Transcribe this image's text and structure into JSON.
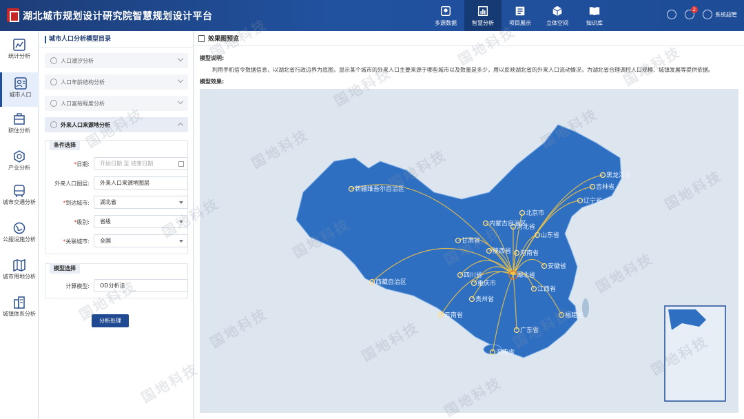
{
  "header": {
    "title": "湖北城市规划设计研究院智慧规划设计平台",
    "nav": [
      {
        "label": "多源数据",
        "icon": "map-pin-icon"
      },
      {
        "label": "智慧分析",
        "icon": "chart-icon",
        "active": true
      },
      {
        "label": "项目展示",
        "icon": "list-icon"
      },
      {
        "label": "立体空间",
        "icon": "cube-icon"
      },
      {
        "label": "知识库",
        "icon": "book-icon"
      }
    ],
    "notification_count": "2",
    "user_name": "系统超管"
  },
  "rail": [
    {
      "label": "统计分析",
      "icon": "chart-icon"
    },
    {
      "label": "城市人口",
      "icon": "person-card-icon",
      "active": true
    },
    {
      "label": "职住分析",
      "icon": "building-icon"
    },
    {
      "label": "产业分析",
      "icon": "hexagon-icon"
    },
    {
      "label": "城市交通分析",
      "icon": "bus-icon"
    },
    {
      "label": "公服设施分析",
      "icon": "globe-icon"
    },
    {
      "label": "城市用地分析",
      "icon": "map-icon"
    },
    {
      "label": "城镇体系分析",
      "icon": "city-icon"
    }
  ],
  "panel": {
    "title": "城市人口分析模型目录",
    "accordion": [
      "人口潮汐分析",
      "人口年龄结构分析",
      "人口富裕程度分析",
      "外来人口来源地分析"
    ],
    "conditions": {
      "title": "条件选择",
      "date_label": "日期:",
      "date_start_placeholder": "开始日期",
      "date_sep": "至",
      "date_end_placeholder": "结束日期",
      "layer_label": "外来人口图层:",
      "layer_value": "外来人口来源地图层",
      "arrive_label": "到达城市:",
      "arrive_value": "湖北省",
      "level_label": "级别:",
      "level_value": "省级",
      "related_label": "关联城市:",
      "related_value": "全国"
    },
    "model": {
      "title": "模型选择",
      "calc_label": "计算模型:",
      "calc_value": "OD分析法"
    },
    "submit_label": "分析处理"
  },
  "main": {
    "title": "效果图预览",
    "desc_label": "模型说明:",
    "desc_text": "利用手机信令数据信息，以湖北省行政边界为底图，显示某个城市的外来人口主要来源于哪些城市以及数量是多少，用以反映湖北省的外来人口流动情况，为湖北省合理调控人口规模、城镇发展等提供依据。",
    "effect_label": "模型效果:"
  },
  "map": {
    "target": "湖北省",
    "provinces": [
      {
        "name": "新疆维吾尔自治区"
      },
      {
        "name": "西藏自治区"
      },
      {
        "name": "黑龙江省"
      },
      {
        "name": "吉林省"
      },
      {
        "name": "辽宁省"
      },
      {
        "name": "内蒙古自治区"
      },
      {
        "name": "北京市"
      },
      {
        "name": "河北省"
      },
      {
        "name": "山东省"
      },
      {
        "name": "甘肃省"
      },
      {
        "name": "陕西省"
      },
      {
        "name": "河南省"
      },
      {
        "name": "安徽省"
      },
      {
        "name": "四川省"
      },
      {
        "name": "重庆市"
      },
      {
        "name": "湖北省"
      },
      {
        "name": "江西省"
      },
      {
        "name": "贵州省"
      },
      {
        "name": "云南省"
      },
      {
        "name": "广东省"
      },
      {
        "name": "福建省"
      },
      {
        "name": "海南省"
      }
    ],
    "colors": {
      "land": "#2f6fc2",
      "sea": "#dde6ef",
      "flow": "#f5c542",
      "target": "#e07020"
    }
  },
  "watermark": "国地科技"
}
